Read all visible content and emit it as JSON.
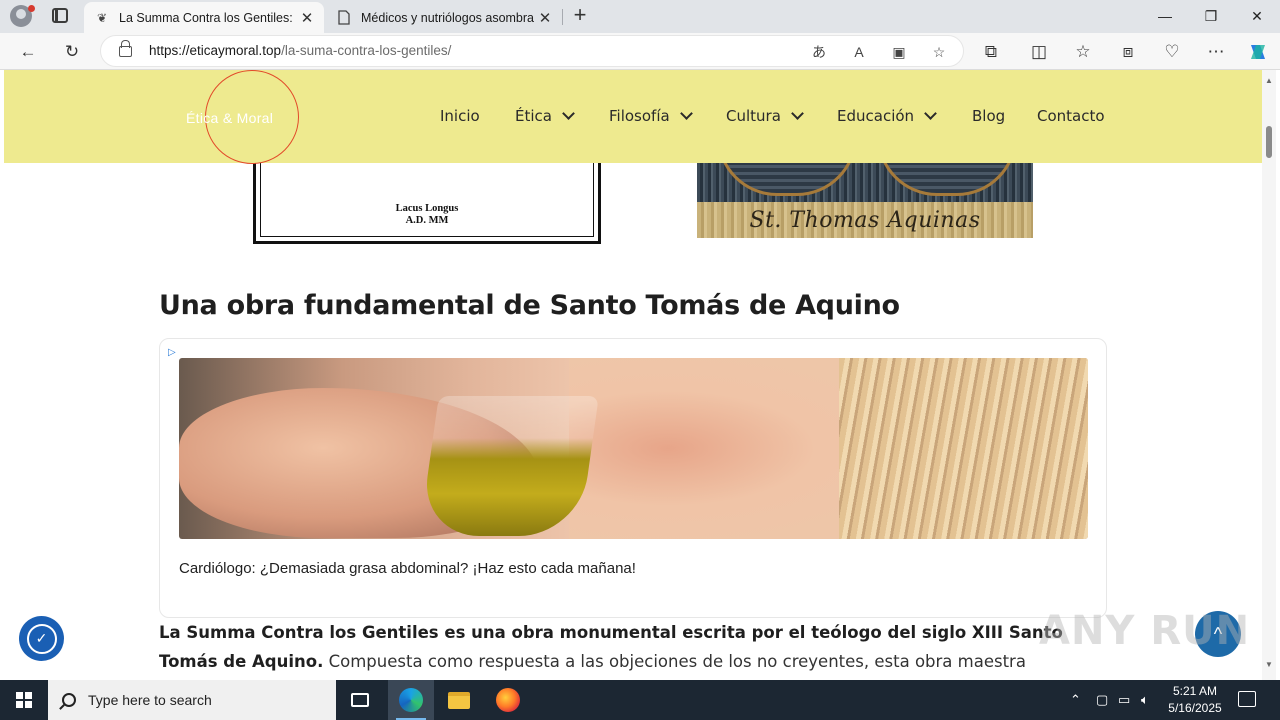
{
  "browser": {
    "tabs": [
      {
        "title": "La Summa Contra los Gentiles: Un",
        "favicon": "site-favicon",
        "active": true
      },
      {
        "title": "Médicos y nutriólogos asombrad",
        "favicon": "page-icon",
        "active": false
      }
    ],
    "url_host": "https://eticaymoral.top",
    "url_path": "/la-suma-contra-los-gentiles/",
    "window_controls": {
      "minimize": "—",
      "restore": "❐",
      "close": "✕"
    }
  },
  "site": {
    "logo": "Ética & Moral",
    "nav": [
      {
        "label": "Inicio",
        "has_dropdown": false
      },
      {
        "label": "Ética",
        "has_dropdown": true
      },
      {
        "label": "Filosofía",
        "has_dropdown": true
      },
      {
        "label": "Cultura",
        "has_dropdown": true
      },
      {
        "label": "Educación",
        "has_dropdown": true
      },
      {
        "label": "Blog",
        "has_dropdown": false
      },
      {
        "label": "Contacto",
        "has_dropdown": false
      }
    ],
    "header_color": "#eeea8f"
  },
  "images": {
    "book_caption_line1": "Lacus Longus",
    "book_caption_line2": "A.D. MM",
    "mosaic_text": "St. Thomas Aquinas"
  },
  "article": {
    "heading": "Una obra fundamental de Santo Tomás de Aquino",
    "ad_caption": "Cardiólogo: ¿Demasiada grasa abdominal? ¡Haz esto cada mañana!",
    "para_bold": "La Summa Contra los Gentiles es una obra monumental escrita por el teólogo del siglo XIII Santo Tomás de Aquino.",
    "para_rest": " Compuesta como respuesta a las objeciones de los no creyentes, esta obra maestra apologética se"
  },
  "overlay": {
    "watermark": "ANY RUN"
  },
  "taskbar": {
    "search_placeholder": "Type here to search",
    "time": "5:21 AM",
    "date": "5/16/2025"
  }
}
